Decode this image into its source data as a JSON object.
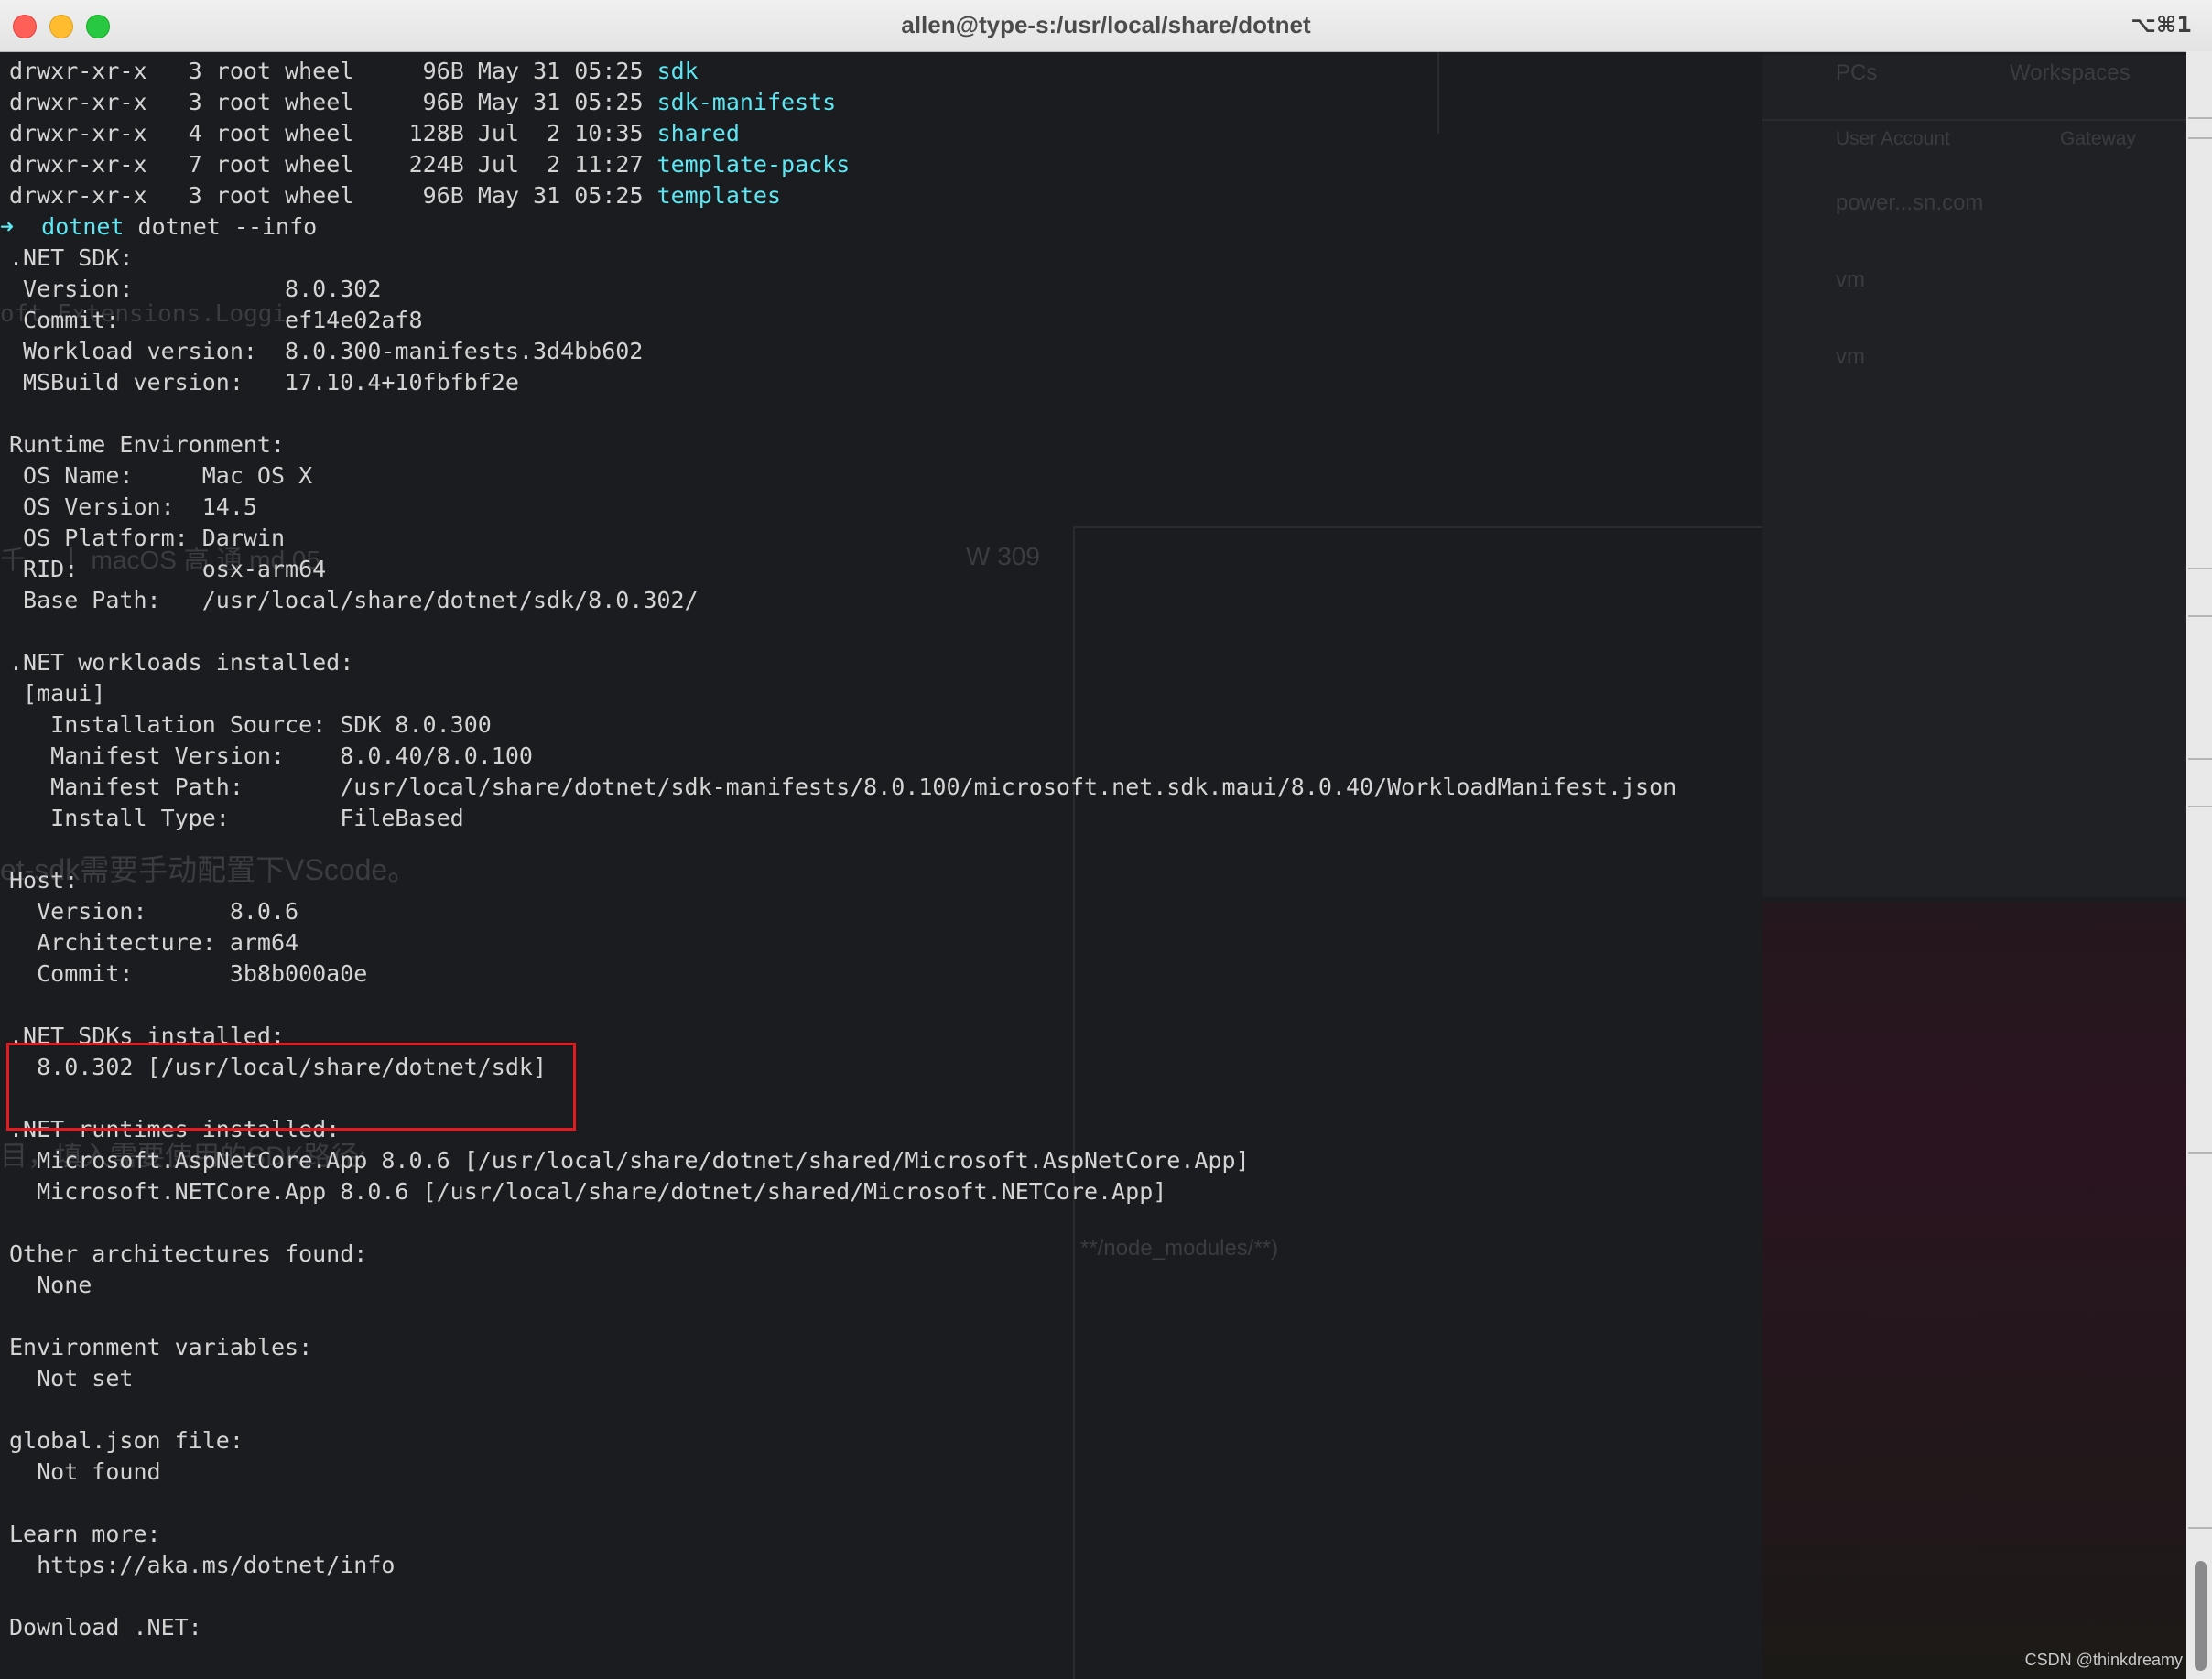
{
  "window": {
    "title": "allen@type-s:/usr/local/share/dotnet",
    "shortcut": "⌥⌘1"
  },
  "background_ghost": {
    "tabs": [
      "PCs",
      "Workspaces"
    ],
    "columns": [
      "User Account",
      "Gateway"
    ],
    "rows": [
      "power...sn.com",
      "vm",
      "vm"
    ],
    "code_snippet": "oft.Extensions.Loggi",
    "meeting": "千 　丨 macOS 高 通 md 05",
    "meeting_room": "W 309",
    "chinese_1": "et-sdk需要手动配置下VScode。",
    "chinese_2": "目，填入需要使用的SDK路径:",
    "search_text": "**/node_modules/**)"
  },
  "terminal": {
    "ls_rows": [
      {
        "perms": "drwxr-xr-x",
        "links": "3",
        "owner": "root",
        "group": "wheel",
        "size": "96B",
        "month": "May",
        "day": "31",
        "time": "05:25",
        "name": "sdk"
      },
      {
        "perms": "drwxr-xr-x",
        "links": "3",
        "owner": "root",
        "group": "wheel",
        "size": "96B",
        "month": "May",
        "day": "31",
        "time": "05:25",
        "name": "sdk-manifests"
      },
      {
        "perms": "drwxr-xr-x",
        "links": "4",
        "owner": "root",
        "group": "wheel",
        "size": "128B",
        "month": "Jul",
        "day": "2",
        "time": "10:35",
        "name": "shared"
      },
      {
        "perms": "drwxr-xr-x",
        "links": "7",
        "owner": "root",
        "group": "wheel",
        "size": "224B",
        "month": "Jul",
        "day": "2",
        "time": "11:27",
        "name": "template-packs"
      },
      {
        "perms": "drwxr-xr-x",
        "links": "3",
        "owner": "root",
        "group": "wheel",
        "size": "96B",
        "month": "May",
        "day": "31",
        "time": "05:25",
        "name": "templates"
      }
    ],
    "prompt_arrow": "➜",
    "prompt_dir": "dotnet",
    "command": "dotnet --info",
    "lines": [
      ".NET SDK:",
      " Version:           8.0.302",
      " Commit:            ef14e02af8",
      " Workload version:  8.0.300-manifests.3d4bb602",
      " MSBuild version:   17.10.4+10fbfbf2e",
      "",
      "Runtime Environment:",
      " OS Name:     Mac OS X",
      " OS Version:  14.5",
      " OS Platform: Darwin",
      " RID:         osx-arm64",
      " Base Path:   /usr/local/share/dotnet/sdk/8.0.302/",
      "",
      ".NET workloads installed:",
      " [maui]",
      "   Installation Source: SDK 8.0.300",
      "   Manifest Version:    8.0.40/8.0.100",
      "   Manifest Path:       /usr/local/share/dotnet/sdk-manifests/8.0.100/microsoft.net.sdk.maui/8.0.40/WorkloadManifest.json",
      "   Install Type:        FileBased",
      "",
      "Host:",
      "  Version:      8.0.6",
      "  Architecture: arm64",
      "  Commit:       3b8b000a0e",
      "",
      ".NET SDKs installed:",
      "  8.0.302 [/usr/local/share/dotnet/sdk]",
      "",
      ".NET runtimes installed:",
      "  Microsoft.AspNetCore.App 8.0.6 [/usr/local/share/dotnet/shared/Microsoft.AspNetCore.App]",
      "  Microsoft.NETCore.App 8.0.6 [/usr/local/share/dotnet/shared/Microsoft.NETCore.App]",
      "",
      "Other architectures found:",
      "  None",
      "",
      "Environment variables:",
      "  Not set",
      "",
      "global.json file:",
      "  Not found",
      "",
      "Learn more:",
      "  https://aka.ms/dotnet/info",
      "",
      "Download .NET:"
    ]
  },
  "watermark": "CSDN @thinkdreamy",
  "colors": {
    "terminal_bg": "#1b1c1f",
    "text": "#d4d4d4",
    "directory": "#5ee6f2",
    "highlight_border": "#e11b1f"
  }
}
